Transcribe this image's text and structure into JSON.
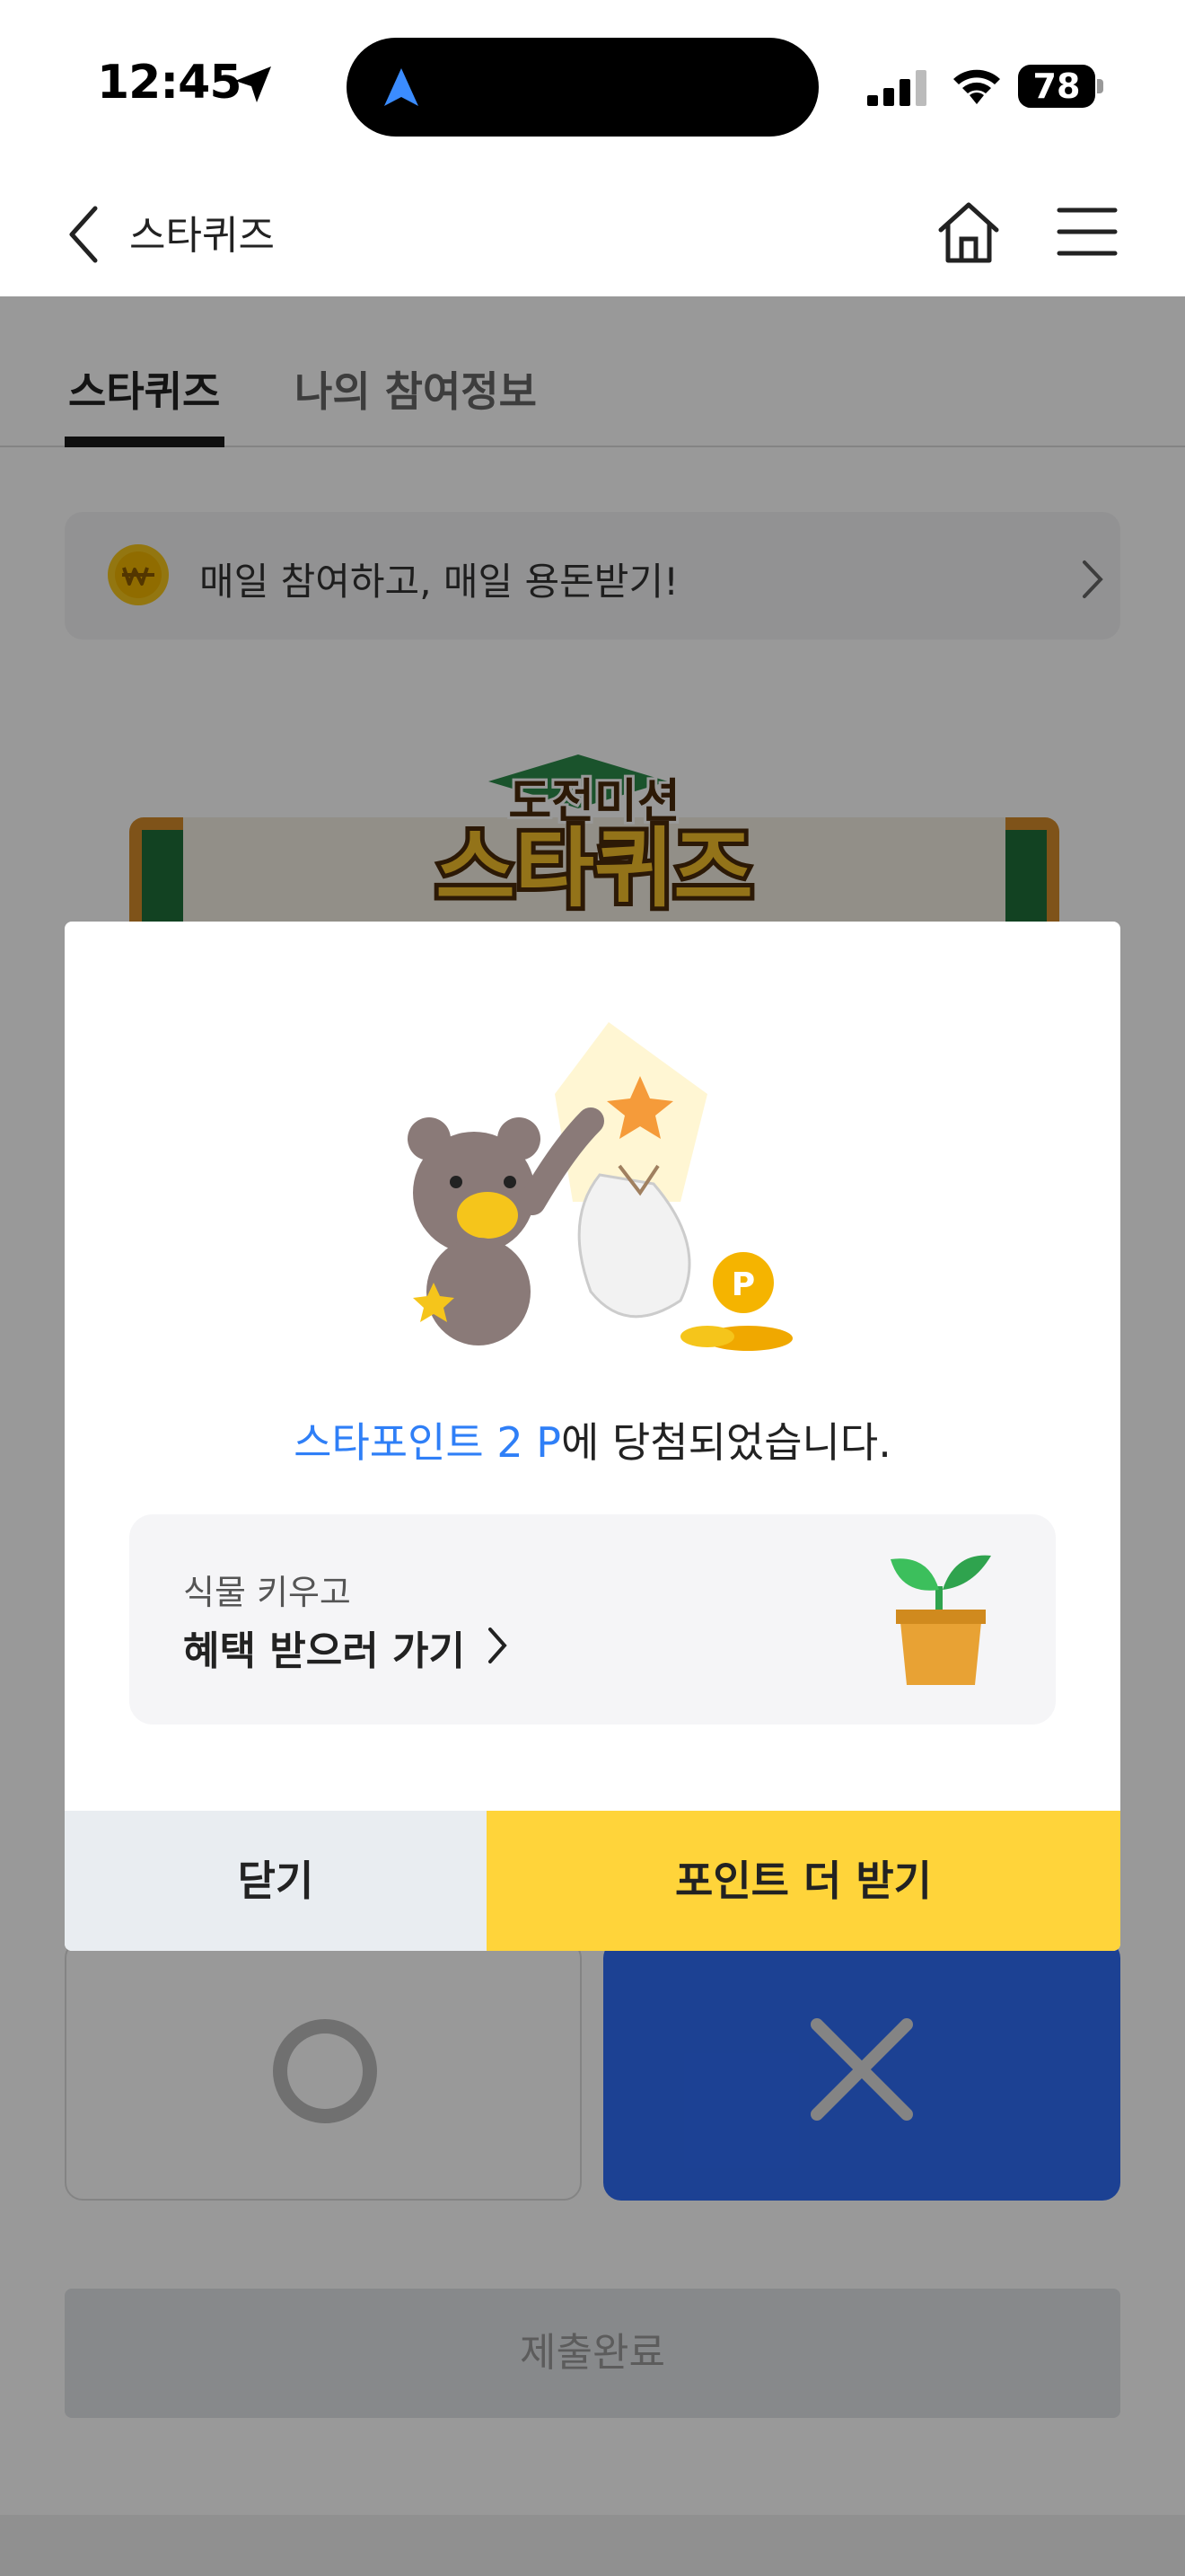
{
  "status_bar": {
    "time": "12:45",
    "battery": "78"
  },
  "header": {
    "title": "스타퀴즈"
  },
  "tabs": [
    {
      "label": "스타퀴즈"
    },
    {
      "label": "나의 참여정보"
    }
  ],
  "banner": {
    "text": "매일 참여하고, 매일 용돈받기!"
  },
  "quiz": {
    "logo_top": "도전미션",
    "logo_main": "스타퀴즈",
    "submit_label": "제출완료"
  },
  "modal": {
    "message_highlight": "스타포인트 2 P",
    "message_rest": "에 당첨되었습니다.",
    "promo_sub": "식물 키우고",
    "promo_main": "혜택 받으러 가기",
    "close_label": "닫기",
    "more_label": "포인트 더 받기"
  },
  "colors": {
    "accent_blue": "#2f7ff7",
    "button_yellow": "#ffd43a",
    "x_choice_blue": "#2f6df6"
  }
}
